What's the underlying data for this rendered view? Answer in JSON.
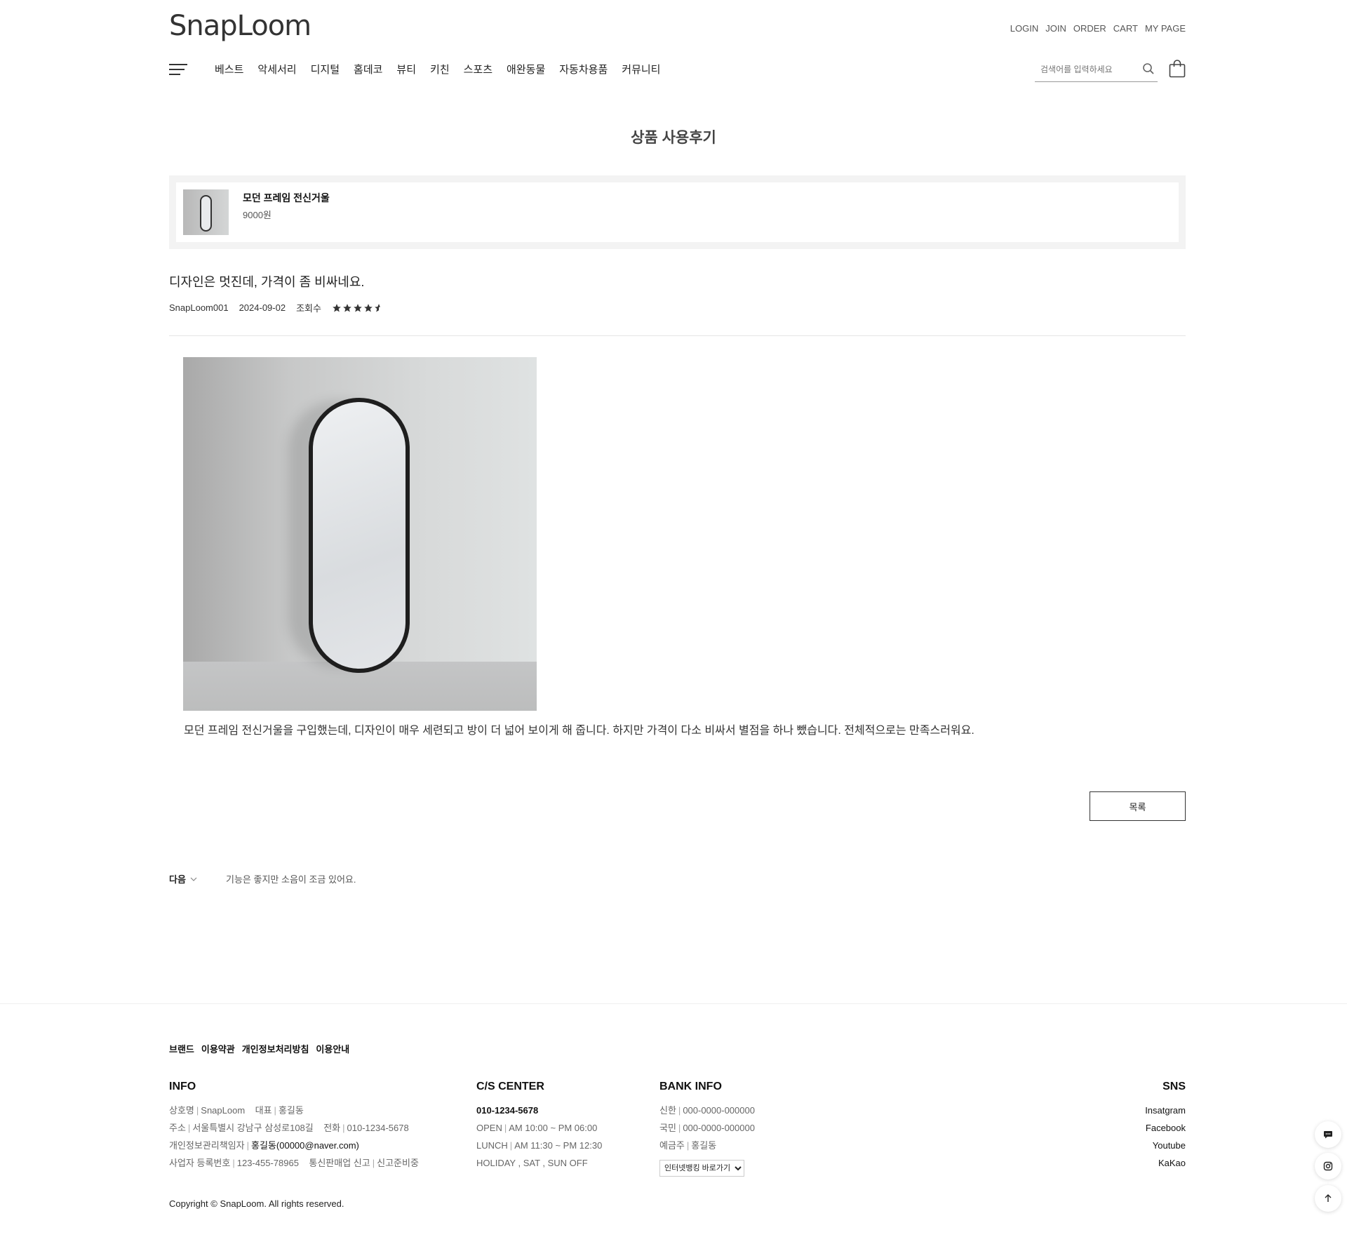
{
  "header": {
    "logo": "SnapLoom",
    "top_links": [
      "LOGIN",
      "JOIN",
      "ORDER",
      "CART",
      "MY PAGE"
    ],
    "menu": [
      "베스트",
      "악세서리",
      "디지털",
      "홈데코",
      "뷰티",
      "키친",
      "스포츠",
      "애완동물",
      "자동차용품",
      "커뮤니티"
    ],
    "search_placeholder": "검색어를 입력하세요",
    "icons": {
      "menu": "hamburger-icon",
      "search": "search-icon",
      "cart": "shopping-bag-icon"
    }
  },
  "page": {
    "title": "상품 사용후기"
  },
  "product": {
    "name": "모던 프레임 전신거울",
    "price": "9000원"
  },
  "review": {
    "title": "디자인은 멋진데, 가격이 좀 비싸네요.",
    "author": "SnapLoom001",
    "date": "2024-09-02",
    "views_label": "조회수",
    "rating": 4.5,
    "body": "모던 프레임 전신거울을 구입했는데, 디자인이 매우 세련되고 방이 더 넓어 보이게 해 줍니다. 하지만 가격이 다소 비싸서 별점을 하나 뺐습니다. 전체적으로는 만족스러워요.",
    "list_button": "목록"
  },
  "navigation": {
    "next_label": "다음",
    "next_title": "기능은 좋지만 소음이 조금 있어요."
  },
  "footer": {
    "links": [
      "브랜드",
      "이용약관",
      "개인정보처리방침",
      "이용안내"
    ],
    "info": {
      "heading": "INFO",
      "company_label": "상호명",
      "company": "SnapLoom",
      "ceo_label": "대표",
      "ceo": "홍길동",
      "address_label": "주소",
      "address": "서울특별시 강남구 삼성로108길",
      "phone_label": "전화",
      "phone": "010-1234-5678",
      "privacy_label": "개인정보관리책임자",
      "privacy": "홍길동(00000@naver.com)",
      "biz_label": "사업자 등록번호",
      "biz": "123-455-78965",
      "mail_order_label": "통신판매업 신고",
      "mail_order": "신고준비중"
    },
    "cs": {
      "heading": "C/S CENTER",
      "phone": "010-1234-5678",
      "open_label": "OPEN",
      "open": "AM 10:00 ~ PM 06:00",
      "lunch_label": "LUNCH",
      "lunch": "AM 11:30 ~ PM 12:30",
      "holiday": "HOLIDAY , SAT , SUN OFF"
    },
    "bank": {
      "heading": "BANK INFO",
      "bank1_label": "신한",
      "bank1": "000-0000-000000",
      "bank2_label": "국민",
      "bank2": "000-0000-000000",
      "holder_label": "예금주",
      "holder": "홍길동",
      "select": "인터넷뱅킹 바로가기"
    },
    "sns": {
      "heading": "SNS",
      "items": [
        "Insatgram",
        "Facebook",
        "Youtube",
        "KaKao"
      ]
    },
    "copyright": "Copyright © SnapLoom. All rights reserved."
  },
  "floating": [
    "chat-icon",
    "instagram-icon",
    "arrow-up-icon"
  ]
}
